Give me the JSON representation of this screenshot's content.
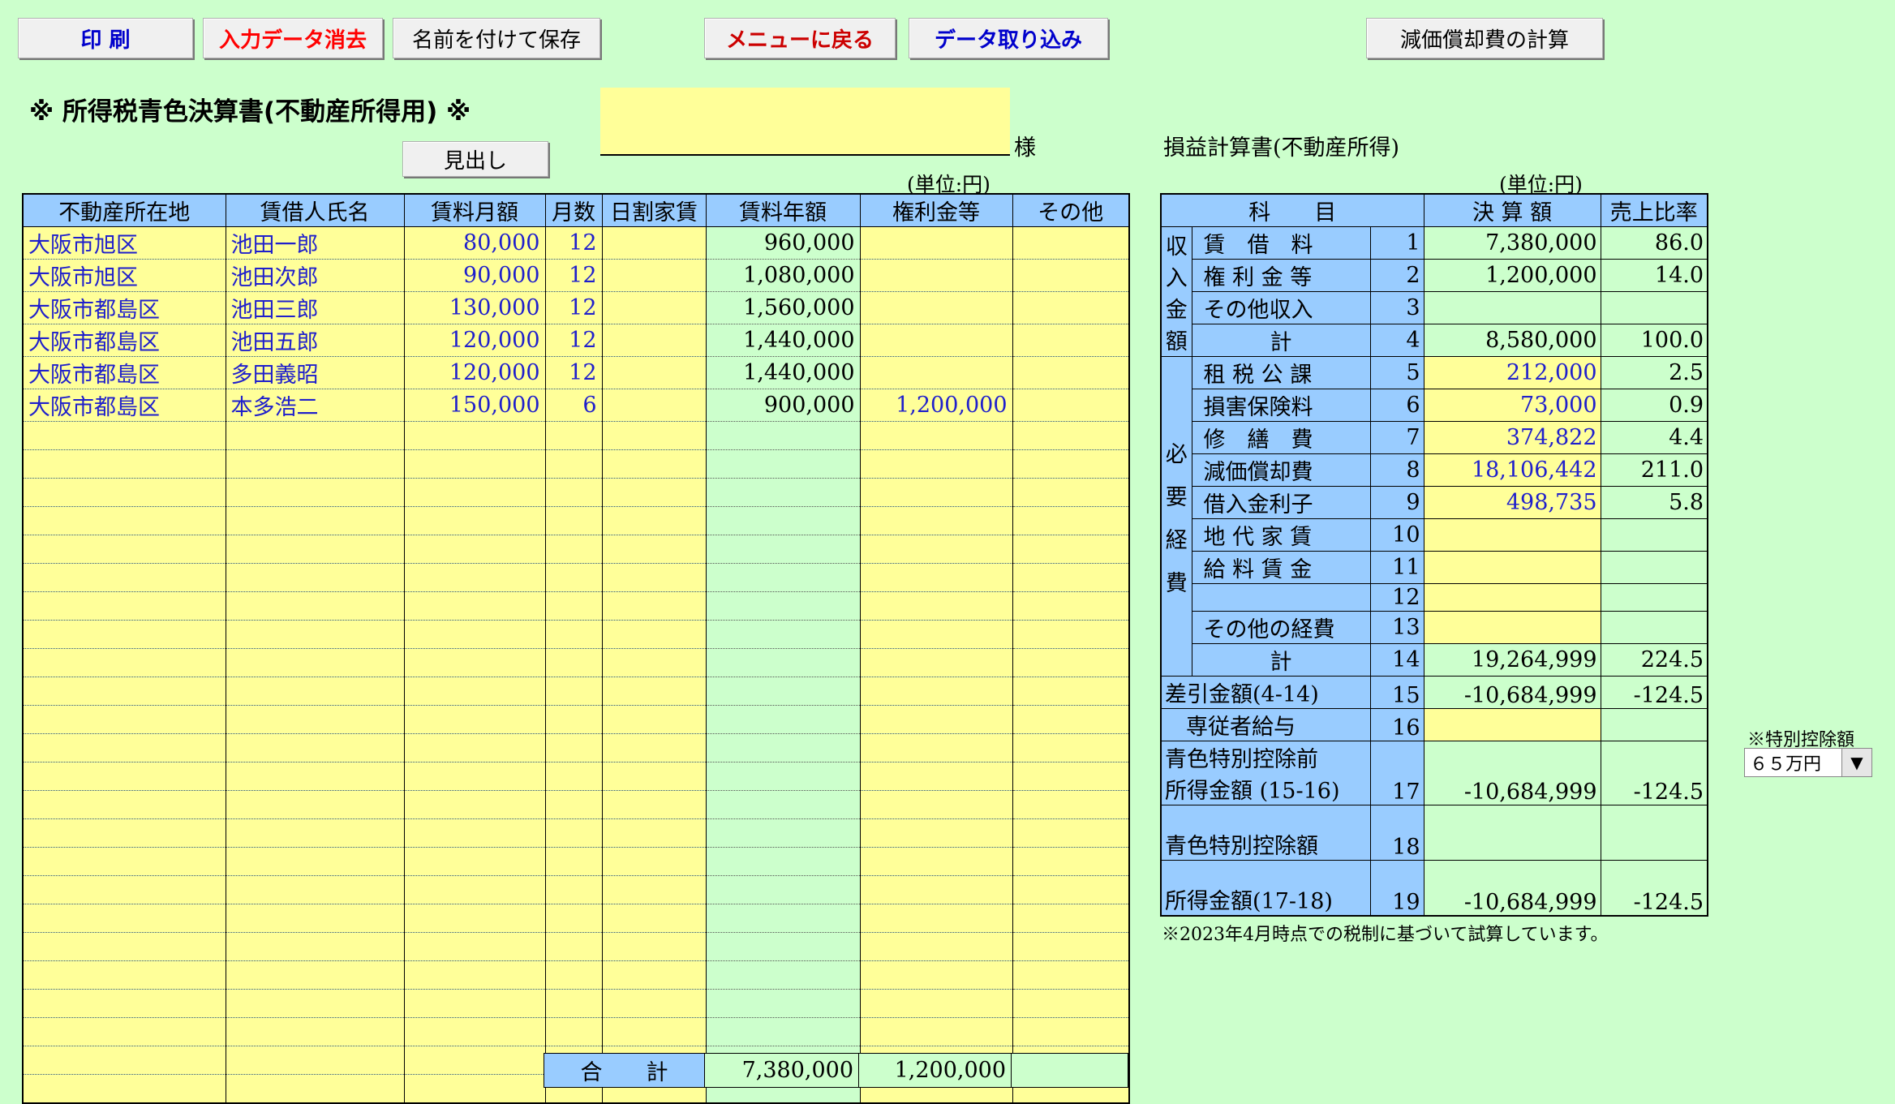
{
  "toolbar": {
    "print": "印 刷",
    "clear": "入力データ消去",
    "save_as": "名前を付けて保存",
    "menu": "メニューに戻る",
    "import": "データ取り込み",
    "depreciation": "減価償却費の計算",
    "colors": {
      "print": "#0000cc",
      "clear": "#ff0000",
      "save_as": "#000000",
      "menu": "#cc0000",
      "import": "#0000cc",
      "depreciation": "#000000"
    }
  },
  "title": "※ 所得税青色決算書(不動産所得用) ※",
  "name_suffix": "様",
  "headings_button": "見出し",
  "income_title": "損益計算書(不動産所得)",
  "unit_label": "(単位:円)",
  "rent_table": {
    "headers": [
      "不動産所在地",
      "賃借人氏名",
      "賃料月額",
      "月数",
      "日割家賃",
      "賃料年額",
      "権利金等",
      "その他"
    ],
    "rows": [
      [
        "大阪市旭区",
        "池田一郎",
        "80,000",
        "12",
        "",
        "960,000",
        "",
        ""
      ],
      [
        "大阪市旭区",
        "池田次郎",
        "90,000",
        "12",
        "",
        "1,080,000",
        "",
        ""
      ],
      [
        "大阪市都島区",
        "池田三郎",
        "130,000",
        "12",
        "",
        "1,560,000",
        "",
        ""
      ],
      [
        "大阪市都島区",
        "池田五郎",
        "120,000",
        "12",
        "",
        "1,440,000",
        "",
        ""
      ],
      [
        "大阪市都島区",
        "多田義昭",
        "120,000",
        "12",
        "",
        "1,440,000",
        "",
        ""
      ],
      [
        "大阪市都島区",
        "本多浩二",
        "150,000",
        "6",
        "",
        "900,000",
        "1,200,000",
        ""
      ]
    ],
    "blank_rows": 24,
    "total_label": "合　　計",
    "total_annual": "7,380,000",
    "total_key_money": "1,200,000",
    "total_other": ""
  },
  "pl": {
    "headers": [
      "科　　目",
      "決 算 額",
      "売上比率"
    ],
    "income_group": [
      "収",
      "入",
      "金",
      "額"
    ],
    "expense_group": [
      "必",
      "要",
      "経",
      "費"
    ],
    "rows": [
      {
        "label": "賃　借　料",
        "no": "1",
        "amount": "7,380,000",
        "ratio": "86.0"
      },
      {
        "label": "権 利 金 等",
        "no": "2",
        "amount": "1,200,000",
        "ratio": "14.0"
      },
      {
        "label": "その他収入",
        "no": "3",
        "amount": "",
        "ratio": ""
      },
      {
        "label": "計",
        "no": "4",
        "amount": "8,580,000",
        "ratio": "100.0"
      },
      {
        "label": "租 税 公 課",
        "no": "5",
        "amount": "212,000",
        "ratio": "2.5"
      },
      {
        "label": "損害保険料",
        "no": "6",
        "amount": "73,000",
        "ratio": "0.9"
      },
      {
        "label": "修　繕　費",
        "no": "7",
        "amount": "374,822",
        "ratio": "4.4"
      },
      {
        "label": "減価償却費",
        "no": "8",
        "amount": "18,106,442",
        "ratio": "211.0"
      },
      {
        "label": "借入金利子",
        "no": "9",
        "amount": "498,735",
        "ratio": "5.8"
      },
      {
        "label": "地 代 家 賃",
        "no": "10",
        "amount": "",
        "ratio": ""
      },
      {
        "label": "給 料 賃 金",
        "no": "11",
        "amount": "",
        "ratio": ""
      },
      {
        "label": "",
        "no": "12",
        "amount": "",
        "ratio": ""
      },
      {
        "label": "その他の経費",
        "no": "13",
        "amount": "",
        "ratio": ""
      },
      {
        "label": "計",
        "no": "14",
        "amount": "19,264,999",
        "ratio": "224.5"
      }
    ],
    "diff": {
      "label": "差引金額(4-14)",
      "no": "15",
      "amount": "-10,684,999",
      "ratio": "-124.5"
    },
    "family_salary": {
      "label": "専従者給与",
      "no": "16",
      "amount": "",
      "ratio": ""
    },
    "pre_deduction": {
      "label1": "青色特別控除前",
      "label2": "所得金額 (15-16)",
      "no": "17",
      "amount": "-10,684,999",
      "ratio": "-124.5"
    },
    "deduction": {
      "label": "青色特別控除額",
      "no": "18",
      "amount": "",
      "ratio": ""
    },
    "income": {
      "label": "所得金額(17-18)",
      "no": "19",
      "amount": "-10,684,999",
      "ratio": "-124.5"
    }
  },
  "deduction_select": {
    "label": "※特別控除額",
    "value": "６５万円"
  },
  "note": "※2023年4月時点での税制に基づいて試算しています。"
}
